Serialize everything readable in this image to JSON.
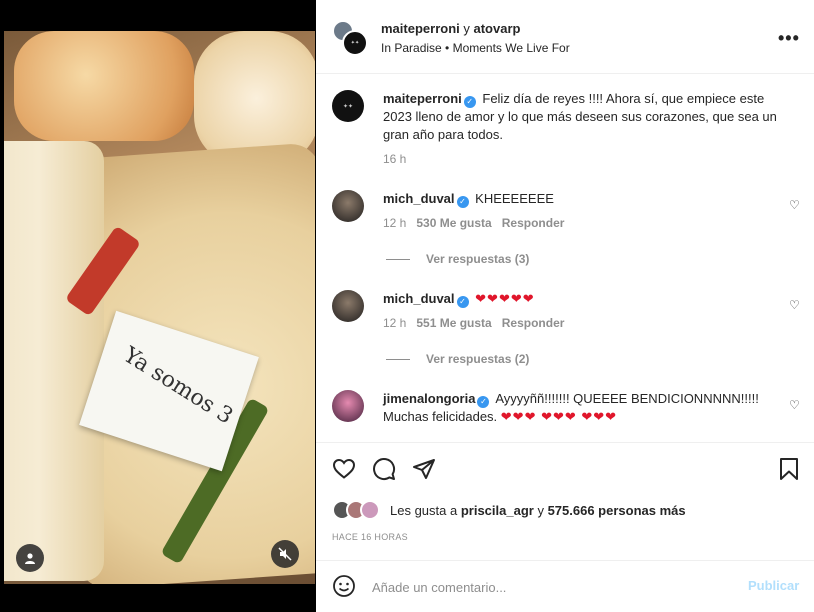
{
  "header": {
    "title_user1": "maiteperroni",
    "title_joiner": " y ",
    "title_user2": "atovarp",
    "subtitle": "In Paradise • Moments We Live For",
    "more_label": "•••"
  },
  "media": {
    "tag_text": "Ya somos 3",
    "user_icon": "user-icon",
    "mute_icon": "muted-speaker-icon"
  },
  "caption": {
    "username": "maiteperroni",
    "text": "Feliz día de reyes !!!! Ahora sí, que empiece este 2023 lleno de amor y lo que más deseen sus corazones, que sea un gran año para todos.",
    "time": "16 h"
  },
  "comments": [
    {
      "username": "mich_duval",
      "text": "KHEEEEEEE",
      "time": "12 h",
      "likes": "530 Me gusta",
      "reply": "Responder",
      "view_replies": "Ver respuestas (3)"
    },
    {
      "username": "mich_duval",
      "text": "❤❤❤❤❤",
      "time": "12 h",
      "likes": "551 Me gusta",
      "reply": "Responder",
      "view_replies": "Ver respuestas (2)"
    },
    {
      "username": "jimenalongoria",
      "text_plain": "Ayyyyññ!!!!!!! QUEEEE BENDICIONNNNN!!!!! Muchas felicidades. ",
      "text_hearts": "❤❤❤ ❤❤❤ ❤❤❤"
    }
  ],
  "likes": {
    "prefix": "Les gusta a ",
    "user": "priscila_agr",
    "joiner": " y ",
    "count": "575.666 personas más"
  },
  "time_ago": "HACE 16 HORAS",
  "add_comment": {
    "placeholder": "Añade un comentario...",
    "publish": "Publicar"
  },
  "colors": {
    "verified": "#3897f0",
    "heart": "#e0162b",
    "publish_disabled": "#b2dffc"
  }
}
